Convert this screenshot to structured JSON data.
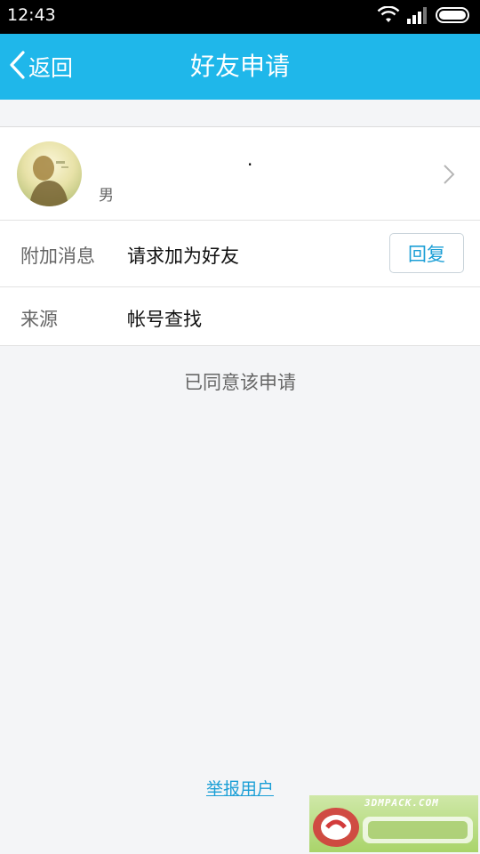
{
  "status_bar": {
    "time": "12:43"
  },
  "header": {
    "back_label": "返回",
    "title": "好友申请"
  },
  "profile": {
    "nickname": "·",
    "gender": "男"
  },
  "info_rows": [
    {
      "label": "附加消息",
      "value": "请求加为好友",
      "action": "回复"
    },
    {
      "label": "来源",
      "value": "帐号查找"
    }
  ],
  "status_message": "已同意该申请",
  "report_link": "举报用户",
  "watermark": {
    "site": "3DMPACK.COM"
  },
  "colors": {
    "header_bg": "#1fb7ea",
    "accent": "#1c9fd6",
    "page_bg": "#f4f5f7"
  },
  "icons": [
    "wifi-icon",
    "signal-icon",
    "battery-icon",
    "back-chevron-icon",
    "chevron-right-icon"
  ]
}
